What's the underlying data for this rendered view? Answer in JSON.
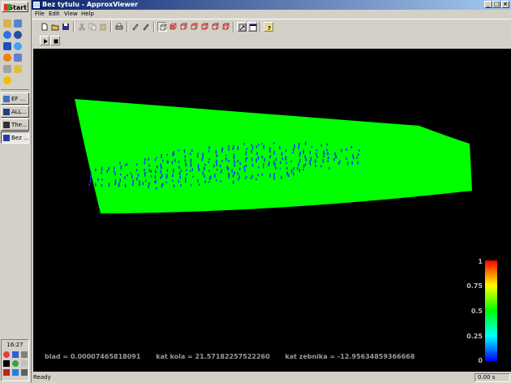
{
  "taskbar": {
    "start_label": "Start",
    "quicklaunch_icons": [
      "desktop-icon",
      "explorer-icon",
      "ie-icon",
      "media-icon",
      "ftp-icon",
      "tool-icon",
      "folder-icon",
      "network-icon",
      "settings-icon"
    ],
    "tasks": [
      {
        "label": "EF ..."
      },
      {
        "label": "ALL..."
      },
      {
        "label": "The..."
      },
      {
        "label": "Bez ..."
      }
    ],
    "clock": "16:27"
  },
  "window": {
    "title": "Bez tytulu - ApproxViewer",
    "controls": {
      "minimize": "_",
      "maximize": "□",
      "close": "×"
    }
  },
  "menu": {
    "items": [
      {
        "label": "File"
      },
      {
        "label": "Edit"
      },
      {
        "label": "View"
      },
      {
        "label": "Help"
      }
    ]
  },
  "viewport": {
    "background": "#000000",
    "mesh_color": "#00ff00",
    "points_color": "#1030ff",
    "overlay": {
      "blad": "blad = 0.00007465818091",
      "kat_kola": "kat kola = 21.57182257522260",
      "kat_zebnika": "kat zebnika = -12.95634859366668"
    },
    "colorbar": {
      "labels": [
        "1",
        "0.75",
        "0.5",
        "0.25",
        "0"
      ]
    }
  },
  "status": {
    "text": "Ready",
    "time": "0.00 s"
  }
}
